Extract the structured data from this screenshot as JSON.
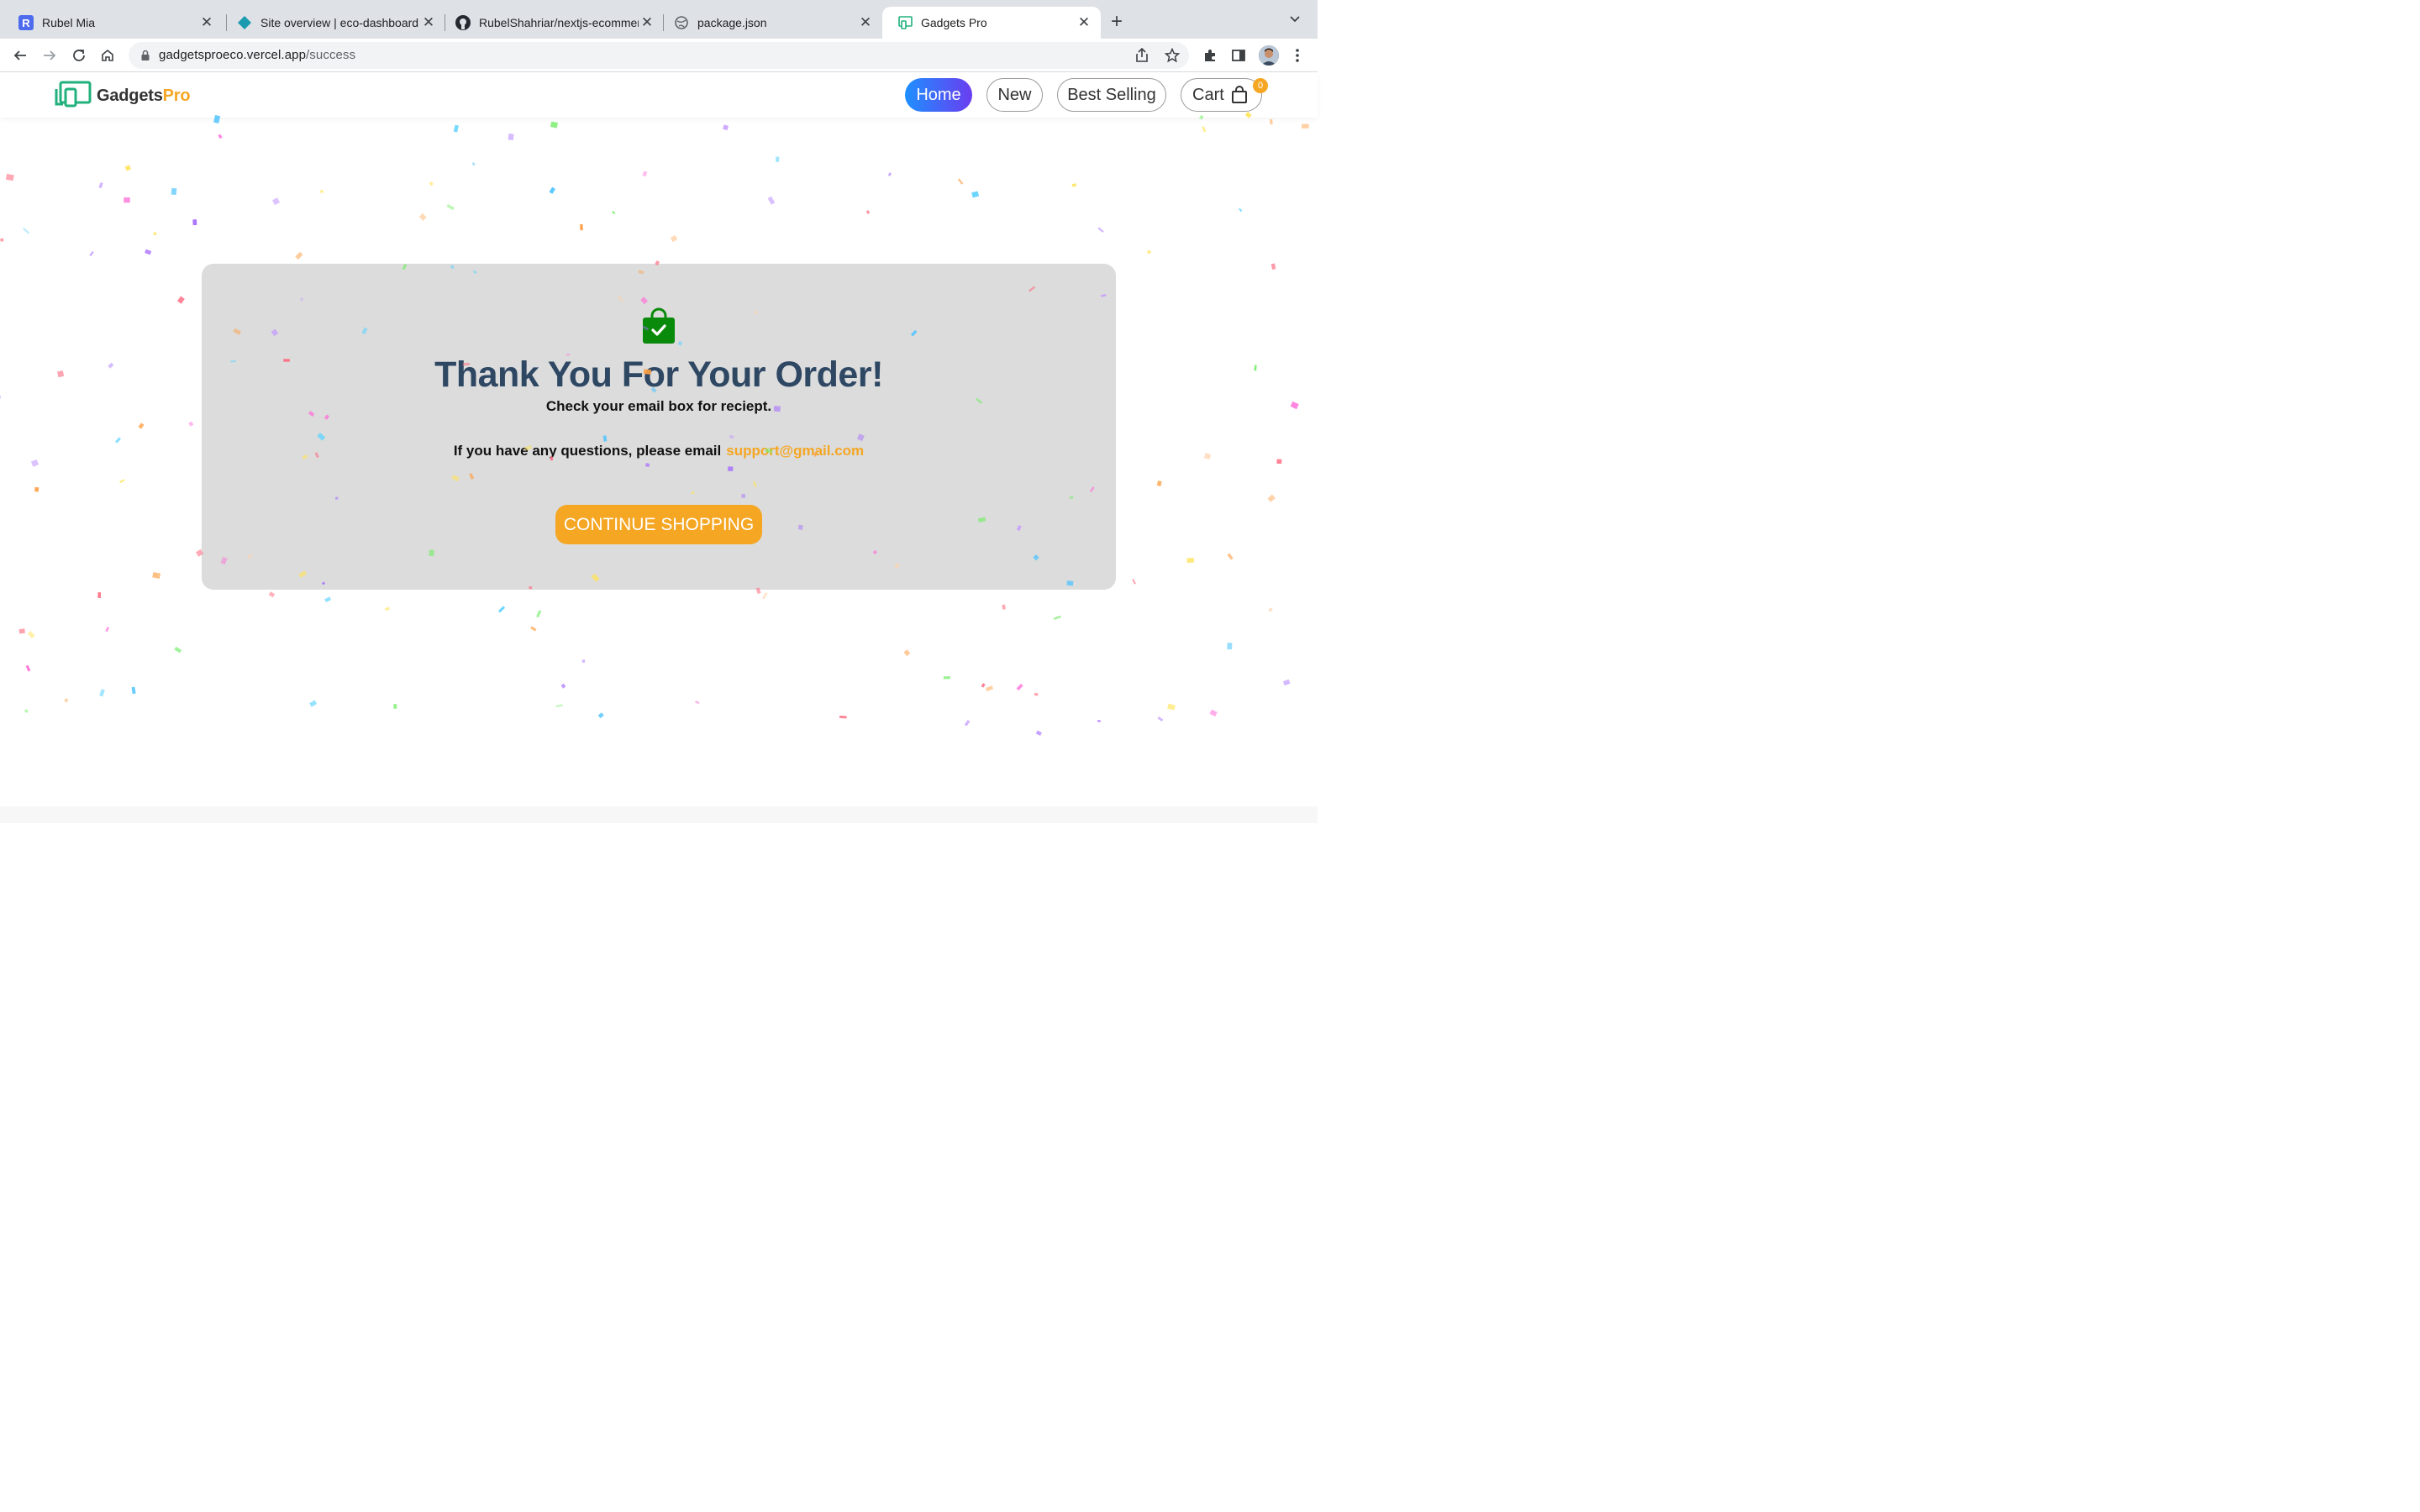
{
  "browser": {
    "tabs": [
      {
        "title": "Rubel Mia",
        "favicon": "r-letter-icon",
        "active": false
      },
      {
        "title": "Site overview | eco-dashboard",
        "favicon": "netlify-diamond-icon",
        "active": false
      },
      {
        "title": "RubelShahriar/nextjs-ecommer",
        "favicon": "github-icon",
        "active": false
      },
      {
        "title": "package.json",
        "favicon": "globe-icon",
        "active": false
      },
      {
        "title": "Gadgets Pro",
        "favicon": "gadgetspro-icon",
        "active": true
      }
    ],
    "url_domain": "gadgetsproeco.vercel.app",
    "url_path": "/success"
  },
  "site": {
    "logo_main": "Gadgets",
    "logo_accent": "Pro",
    "nav": {
      "home": "Home",
      "new": "New",
      "best_selling": "Best Selling",
      "cart": "Cart",
      "cart_count": "0"
    }
  },
  "success": {
    "title": "Thank You For Your Order!",
    "subtitle": "Check your email box for reciept.",
    "questions": "If you have any questions, please email",
    "email": "support@gmail.com",
    "button": "CONTINUE SHOPPING"
  },
  "colors": {
    "accent": "#f5a623",
    "title": "#2e4763",
    "card": "#dcdcdc",
    "bag": "#0a8a0a",
    "home_gradient_start": "#1e90ff",
    "home_gradient_end": "#6a3df0"
  }
}
